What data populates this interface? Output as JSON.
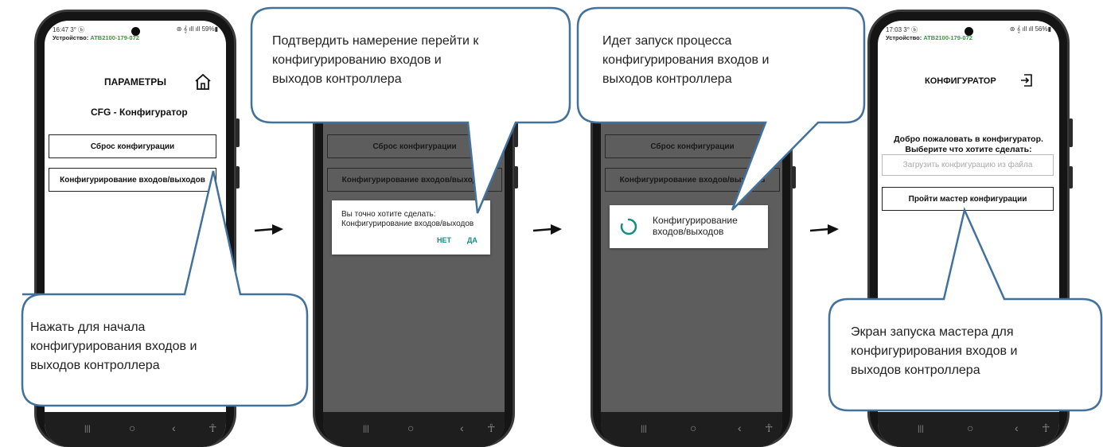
{
  "phone1": {
    "time": "16:47 3° ⓑ",
    "signal": "⊛ 𝄞 ıll ıll 59%▮",
    "device_label": "Устройство:",
    "device_id": "ATB2100-179-072",
    "title": "ПАРАМЕТРЫ",
    "subtitle": "CFG - Конфигуратор",
    "btn_reset": "Сброс конфигурации",
    "btn_config": "Конфигурирование входов/выходов"
  },
  "phone2": {
    "btn_reset": "Сброс конфигурации",
    "btn_config": "Конфигурирование входов/выходов",
    "dialog_line1": "Вы точно хотите сделать:",
    "dialog_line2": "Конфигурирование входов/выходов",
    "dialog_no": "НЕТ",
    "dialog_yes": "ДА"
  },
  "phone3": {
    "btn_reset": "Сброс конфигурации",
    "btn_config": "Конфигурирование входов/выходов",
    "progress_line1": "Конфигурирование",
    "progress_line2": "входов/выходов"
  },
  "phone4": {
    "time": "17:03 3° ⓑ",
    "signal": "⊛ 𝄞 ıll ıll 56%▮",
    "device_label": "Устройство:",
    "device_id": "ATB2100-179-072",
    "title": "КОНФИГУРАТОР",
    "welcome_line1": "Добро пожаловать в конфигуратор.",
    "welcome_line2": "Выберите что хотите сделать:",
    "btn_load": "Загрузить конфигурацию из файла",
    "btn_wizard": "Пройти мастер конфигурации"
  },
  "callouts": {
    "c1": [
      "Нажать для начала",
      "конфигурирования входов и",
      "выходов контроллера"
    ],
    "c2": [
      "Подтвердить намерение перейти к",
      "конфигурированию входов и",
      "выходов контроллера"
    ],
    "c3": [
      "Идет запуск процесса",
      "конфигурирования входов и",
      "выходов контроллера"
    ],
    "c4": [
      "Экран запуска мастера для",
      "конфигурирования входов и",
      "выходов контроллера"
    ]
  },
  "nav": {
    "recents": "|||",
    "home": "○",
    "back": "‹",
    "access": "☥"
  },
  "colors": {
    "callout_fill": "#ffffff",
    "callout_stroke": "#41719c",
    "accent_green": "#2e9e3a",
    "dialog_teal": "#148f7e"
  }
}
